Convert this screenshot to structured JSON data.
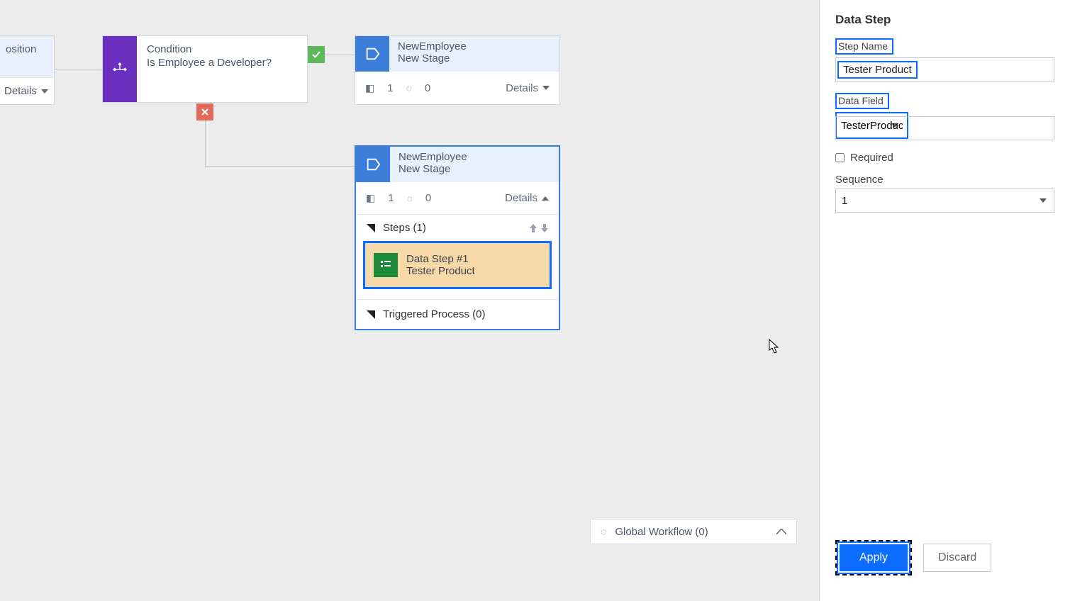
{
  "canvas": {
    "partial_node": {
      "title": "osition",
      "details": "Details"
    },
    "condition": {
      "kind": "Condition",
      "question": "Is Employee a Developer?"
    },
    "stage1": {
      "entity": "NewEmployee",
      "name": "New Stage",
      "steps_count": "1",
      "triggers_count": "0",
      "details": "Details"
    },
    "stage2": {
      "entity": "NewEmployee",
      "name": "New Stage",
      "steps_count": "1",
      "triggers_count": "0",
      "details": "Details",
      "steps_header": "Steps (1)",
      "step_card": {
        "title": "Data Step #1",
        "subtitle": "Tester Product"
      },
      "triggered_header": "Triggered Process (0)"
    },
    "global_workflow": "Global Workflow (0)"
  },
  "side_panel": {
    "title": "Data Step",
    "step_name_label": "Step Name",
    "step_name_value": "Tester Product",
    "data_field_label": "Data Field",
    "data_field_value": "TesterProduct",
    "required_label": "Required",
    "sequence_label": "Sequence",
    "sequence_value": "1",
    "apply": "Apply",
    "discard": "Discard"
  }
}
